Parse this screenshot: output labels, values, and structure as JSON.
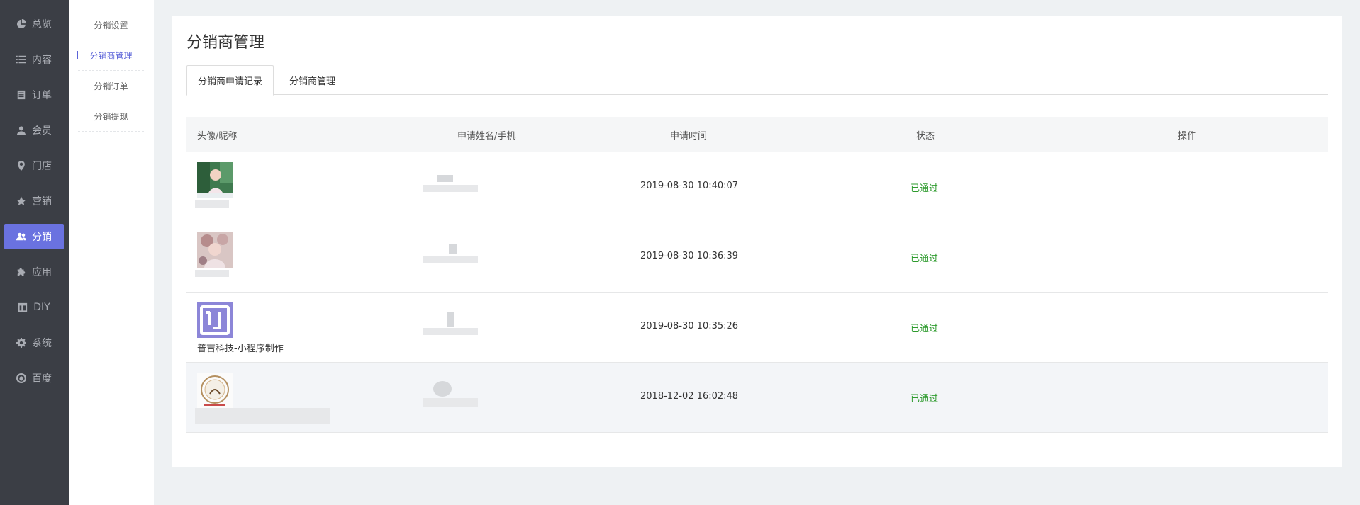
{
  "sidebar": {
    "items": [
      {
        "label": "总览",
        "icon": "pie-chart-icon"
      },
      {
        "label": "内容",
        "icon": "list-icon"
      },
      {
        "label": "订单",
        "icon": "document-icon"
      },
      {
        "label": "会员",
        "icon": "user-icon"
      },
      {
        "label": "门店",
        "icon": "map-pin-icon"
      },
      {
        "label": "营销",
        "icon": "star-icon"
      },
      {
        "label": "分销",
        "icon": "users-icon",
        "active": true
      },
      {
        "label": "应用",
        "icon": "puzzle-icon"
      },
      {
        "label": "DIY",
        "icon": "layout-icon"
      },
      {
        "label": "系统",
        "icon": "gear-icon"
      },
      {
        "label": "百度",
        "icon": "baidu-icon"
      }
    ]
  },
  "subnav": {
    "items": [
      {
        "label": "分销设置"
      },
      {
        "label": "分销商管理",
        "active": true
      },
      {
        "label": "分销订单"
      },
      {
        "label": "分销提现"
      }
    ]
  },
  "page": {
    "title": "分销商管理",
    "tabs": [
      {
        "label": "分销商申请记录",
        "active": true
      },
      {
        "label": "分销商管理"
      }
    ]
  },
  "table": {
    "headers": {
      "avatar": "头像/昵称",
      "name_phone": "申请姓名/手机",
      "time": "申请时间",
      "status": "状态",
      "action": "操作"
    },
    "rows": [
      {
        "nickname": "",
        "time": "2019-08-30 10:40:07",
        "status": "已通过"
      },
      {
        "nickname": "",
        "time": "2019-08-30 10:36:39",
        "status": "已通过"
      },
      {
        "nickname": "普吉科技-小程序制作",
        "time": "2019-08-30 10:35:26",
        "status": "已通过"
      },
      {
        "nickname": "",
        "time": "2018-12-02 16:02:48",
        "status": "已通过"
      }
    ]
  },
  "colors": {
    "sidebar_bg": "#3b3e45",
    "accent": "#6a72e0",
    "status_green": "#2e9b2e"
  }
}
